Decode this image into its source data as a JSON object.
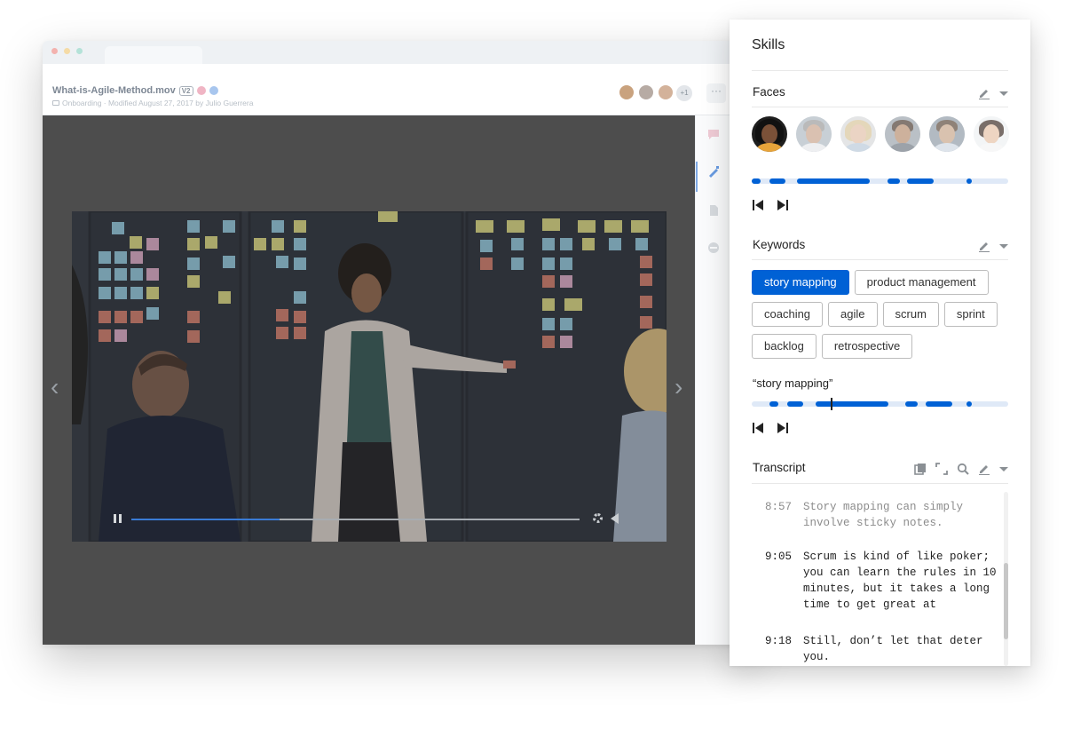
{
  "file": {
    "name": "What-is-Agile-Method.mov",
    "version": "V2",
    "subtitle": "Onboarding · Modified August 27, 2017 by Julio Guerrera",
    "collaborator_overflow": "+1",
    "more_label": "···"
  },
  "player": {
    "prev_label": "‹",
    "next_label": "›",
    "progress": 0.33
  },
  "skills": {
    "title": "Skills",
    "faces": {
      "title": "Faces",
      "people": [
        "face-1",
        "face-2",
        "face-3",
        "face-4",
        "face-5",
        "face-6"
      ],
      "selected_index": 0
    },
    "keywords": {
      "title": "Keywords",
      "items": [
        "story mapping",
        "product management",
        "coaching",
        "agile",
        "scrum",
        "sprint",
        "backlog",
        "retrospective"
      ],
      "selected_index": 0,
      "selected_label": "“story mapping”"
    },
    "transcript": {
      "title": "Transcript",
      "entries": [
        {
          "time": "8:57",
          "text": "Story mapping can simply involve sticky notes.",
          "dim": true
        },
        {
          "time": "9:05",
          "text": "Scrum is kind of like poker; you can learn the rules in 10 minutes, but it takes a long time to get great at",
          "dim": false
        },
        {
          "time": "9:18",
          "text": "Still, don’t let that deter you.",
          "dim": false
        }
      ]
    }
  },
  "colors": {
    "accent": "#0061d5",
    "track": "#dfe9f7",
    "player_bg": "#4d4d4d"
  }
}
